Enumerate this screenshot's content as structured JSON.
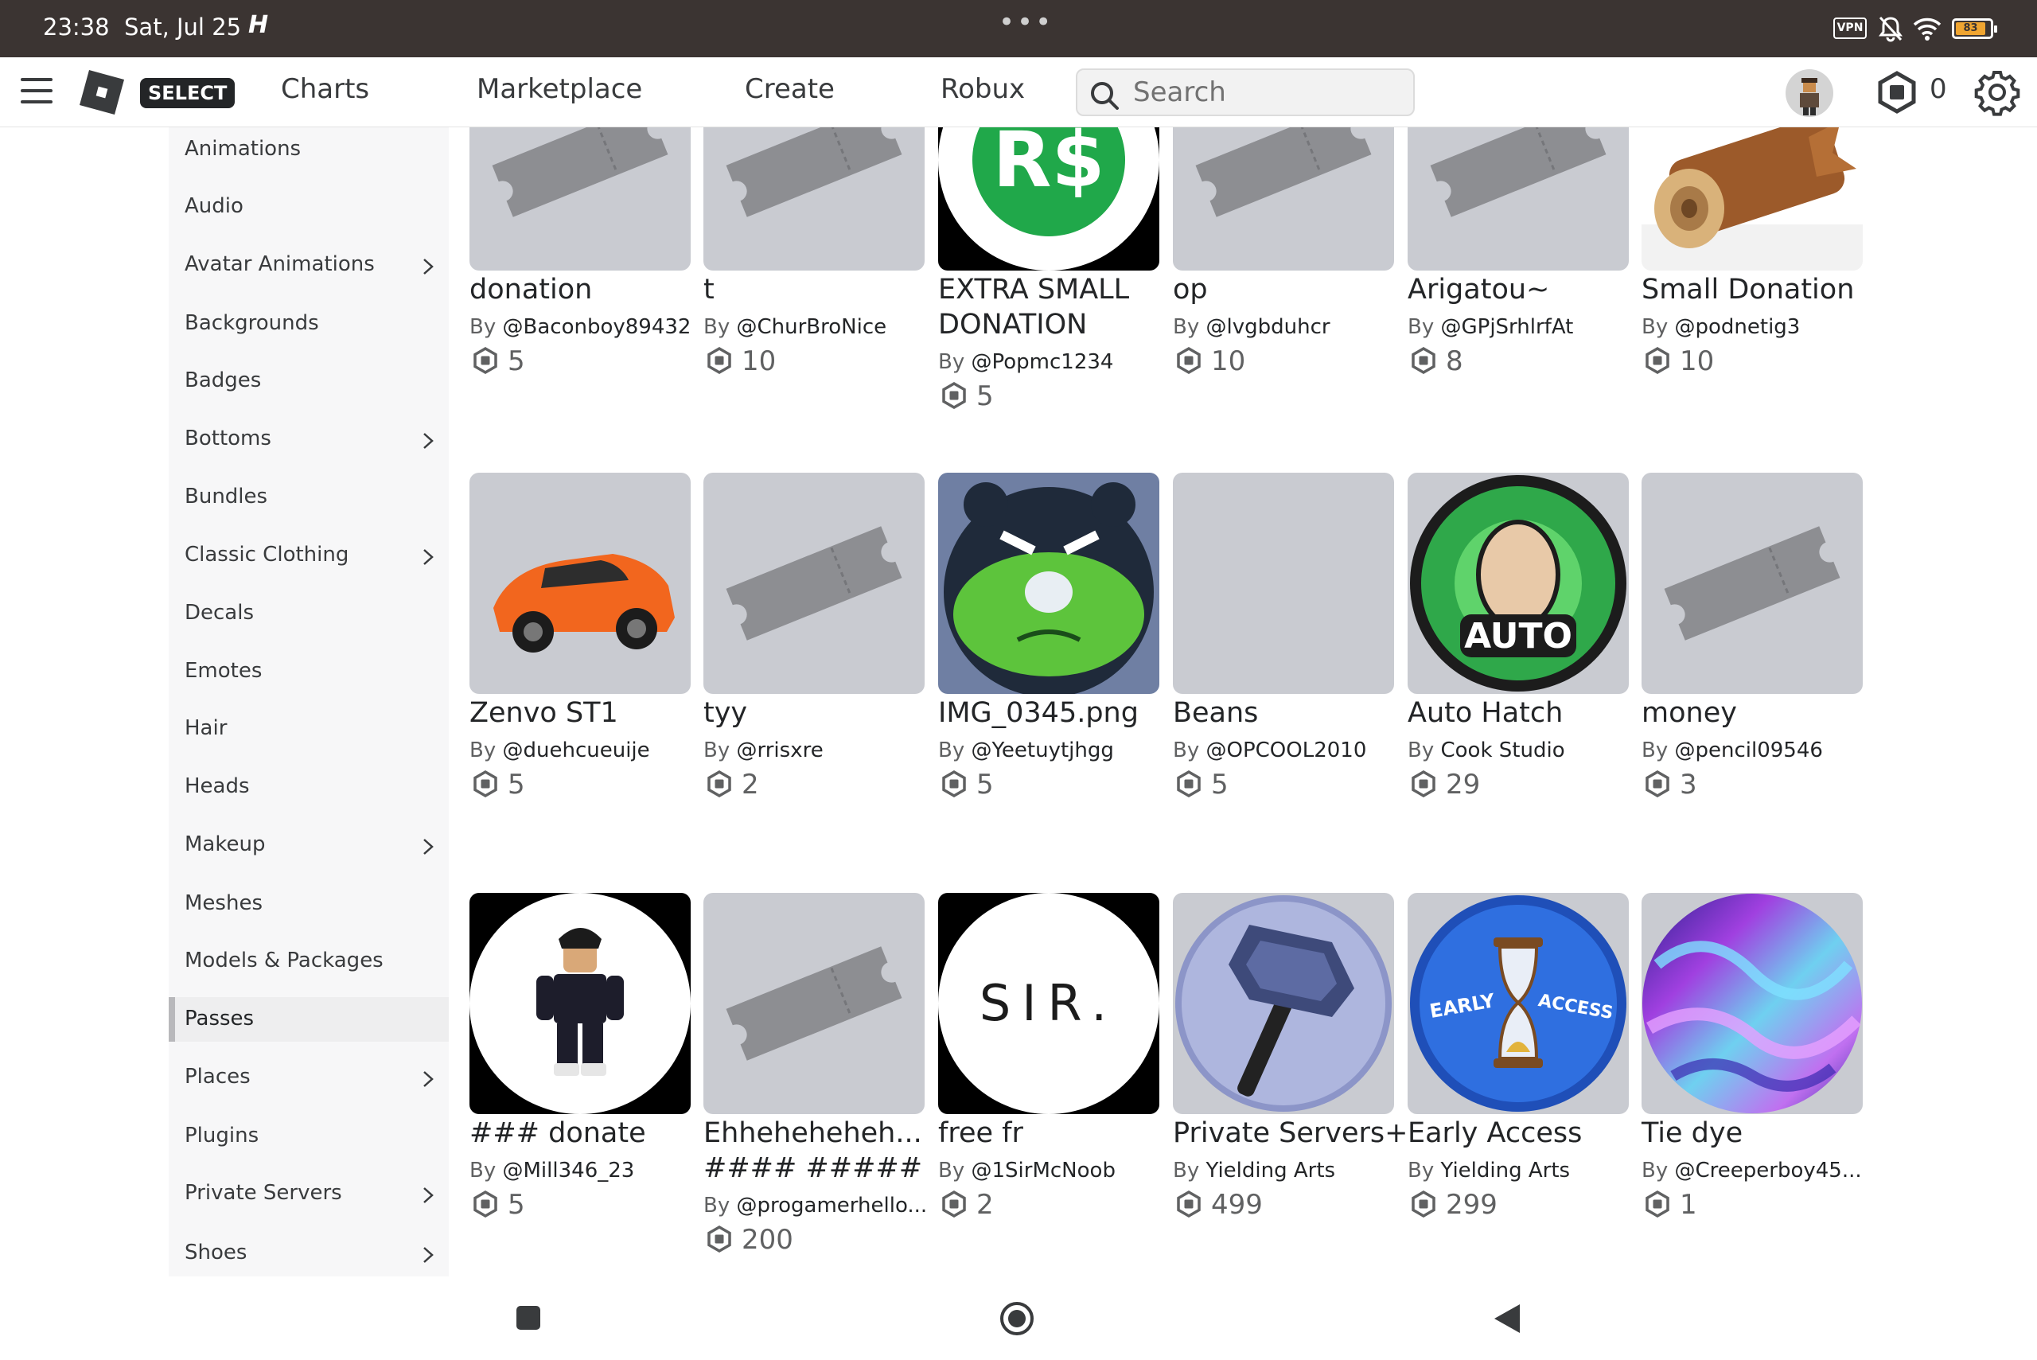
{
  "status_bar": {
    "time": "23:38",
    "date": "Sat, Jul 25",
    "vpn": "VPN",
    "battery": "83"
  },
  "nav": {
    "badge": "SELECT",
    "links": [
      "Charts",
      "Marketplace",
      "Create",
      "Robux"
    ],
    "search_placeholder": "Search",
    "robux_balance": "0"
  },
  "sidebar": {
    "items": [
      {
        "label": "Animations"
      },
      {
        "label": "Audio"
      },
      {
        "label": "Avatar Animations"
      },
      {
        "label": "Backgrounds"
      },
      {
        "label": "Badges"
      },
      {
        "label": "Bottoms"
      },
      {
        "label": "Bundles"
      },
      {
        "label": "Classic Clothing"
      },
      {
        "label": "Decals"
      },
      {
        "label": "Emotes"
      },
      {
        "label": "Hair"
      },
      {
        "label": "Heads"
      },
      {
        "label": "Makeup"
      },
      {
        "label": "Meshes"
      },
      {
        "label": "Models & Packages"
      },
      {
        "label": "Passes"
      },
      {
        "label": "Places"
      },
      {
        "label": "Plugins"
      },
      {
        "label": "Private Servers"
      },
      {
        "label": "Shoes"
      }
    ]
  },
  "items": [
    {
      "title": "donation",
      "by": "By",
      "creator": "@Baconboy89432",
      "price": "5"
    },
    {
      "title": "t",
      "by": "By",
      "creator": "@ChurBroNice",
      "price": "10"
    },
    {
      "title": "EXTRA SMALL",
      "title2": "DONATION",
      "by": "By",
      "creator": "@Popmc1234",
      "price": "5",
      "robux_logo_text": "R$"
    },
    {
      "title": "op",
      "by": "By",
      "creator": "@lvgbduhcr",
      "price": "10"
    },
    {
      "title": "Arigatou~",
      "by": "By",
      "creator": "@GPjSrhlrfAt",
      "price": "8"
    },
    {
      "title": "Small Donation",
      "by": "By",
      "creator": "@podnetig3",
      "price": "10"
    },
    {
      "title": "Zenvo ST1",
      "by": "By",
      "creator": "@duehcueuije",
      "price": "5"
    },
    {
      "title": "tyy",
      "by": "By",
      "creator": "@rrisxre",
      "price": "2"
    },
    {
      "title": "IMG_0345.png",
      "by": "By",
      "creator": "@Yeetuytjhgg",
      "price": "5"
    },
    {
      "title": "Beans",
      "by": "By",
      "creator": "@OPCOOL2010",
      "price": "5"
    },
    {
      "title": "Auto Hatch",
      "by": "By",
      "creator": "Cook Studio",
      "price": "29",
      "badge_text": "AUTO"
    },
    {
      "title": "money",
      "by": "By",
      "creator": "@pencil09546",
      "price": "3"
    },
    {
      "title": "### donate",
      "by": "By",
      "creator": "@Mill346_23",
      "price": "5"
    },
    {
      "title": "Ehheheheheh...",
      "title2": "#### #####",
      "by": "By",
      "creator": "@progamerhello...",
      "price": "200"
    },
    {
      "title": "free fr",
      "by": "By",
      "creator": "@1SirMcNoob",
      "price": "2",
      "thumb_text": "SIR."
    },
    {
      "title": "Private Servers+",
      "by": "By",
      "creator": "Yielding Arts",
      "price": "499"
    },
    {
      "title": "Early Access",
      "by": "By",
      "creator": "Yielding Arts",
      "price": "299",
      "thumb_text_left": "EARLY",
      "thumb_text_right": "ACCESS"
    },
    {
      "title": "Tie dye",
      "by": "By",
      "creator": "@Creeperboy45...",
      "price": "1"
    }
  ]
}
